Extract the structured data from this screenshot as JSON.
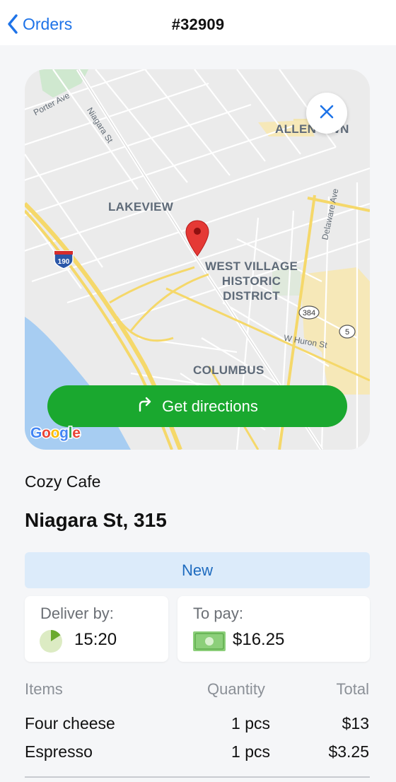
{
  "header": {
    "back_label": "Orders",
    "title": "#32909"
  },
  "map": {
    "labels": {
      "lakeview": "LAKEVIEW",
      "west_village": "WEST VILLAGE\nHISTORIC\nDISTRICT",
      "columbus": "COLUMBUS",
      "allentown": "ALLEN  WN"
    },
    "streets": {
      "porter": "Porter Ave",
      "niagara": "Niagara St",
      "delaware": "Delaware Ave",
      "huron": "W Huron St"
    },
    "shields": {
      "i190": "190",
      "r384": "384",
      "r5": "5"
    },
    "google_logo": "Google",
    "directions_label": "Get directions",
    "close_icon": "close-icon",
    "pin_icon": "map-pin-icon"
  },
  "order": {
    "shop_name": "Cozy Cafe",
    "address": "Niagara St, 315",
    "status": "New",
    "deliver_by_label": "Deliver by:",
    "deliver_by_time": "15:20",
    "to_pay_label": "To pay:",
    "to_pay_amount": "$16.25"
  },
  "items_table": {
    "headers": [
      "Items",
      "Quantity",
      "Total"
    ],
    "rows": [
      {
        "name": "Four cheese",
        "quantity": "1 pcs",
        "total": "$13"
      },
      {
        "name": "Espresso",
        "quantity": "1 pcs",
        "total": "$3.25"
      }
    ]
  },
  "colors": {
    "accent_blue": "#1e73e8",
    "directions_green": "#1aa82f",
    "status_bg": "#dcebfa",
    "pin_red": "#e53935"
  }
}
